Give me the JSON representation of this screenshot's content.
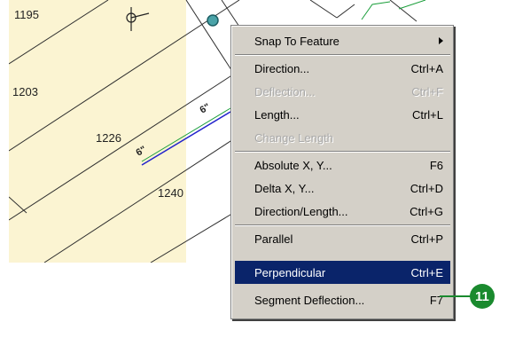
{
  "map": {
    "lot_labels": [
      "1195",
      "1203",
      "1226",
      "1240"
    ],
    "marker_labels": [
      "6\"",
      "6\""
    ],
    "colors": {
      "parcel_fill": "#fbf4d2",
      "parcel_line": "#2f2f2f",
      "edited_line": "#2222cc",
      "snap_line": "#1a9e3a"
    }
  },
  "context_menu": {
    "items": [
      {
        "label": "Snap To Feature",
        "shortcut": "",
        "submenu": true,
        "enabled": true
      },
      {
        "label": "Direction...",
        "shortcut": "Ctrl+A",
        "enabled": true
      },
      {
        "label": "Deflection...",
        "shortcut": "Ctrl+F",
        "enabled": false
      },
      {
        "label": "Length...",
        "shortcut": "Ctrl+L",
        "enabled": true
      },
      {
        "label": "Change Length",
        "shortcut": "",
        "enabled": false
      },
      {
        "label": "Absolute X, Y...",
        "shortcut": "F6",
        "enabled": true
      },
      {
        "label": "Delta X, Y...",
        "shortcut": "Ctrl+D",
        "enabled": true
      },
      {
        "label": "Direction/Length...",
        "shortcut": "Ctrl+G",
        "enabled": true
      },
      {
        "label": "Parallel",
        "shortcut": "Ctrl+P",
        "enabled": true
      },
      {
        "label": "Perpendicular",
        "shortcut": "Ctrl+E",
        "enabled": true,
        "highlighted": true
      },
      {
        "label": "Segment Deflection...",
        "shortcut": "F7",
        "enabled": true
      }
    ]
  },
  "callout": {
    "number": "11",
    "color": "#1a8a2e"
  },
  "theme": {
    "menu_bg": "#d4d0c8",
    "highlight_bg": "#0a246a",
    "highlight_text": "#ffffff",
    "disabled_text": "#a8a8a8"
  }
}
